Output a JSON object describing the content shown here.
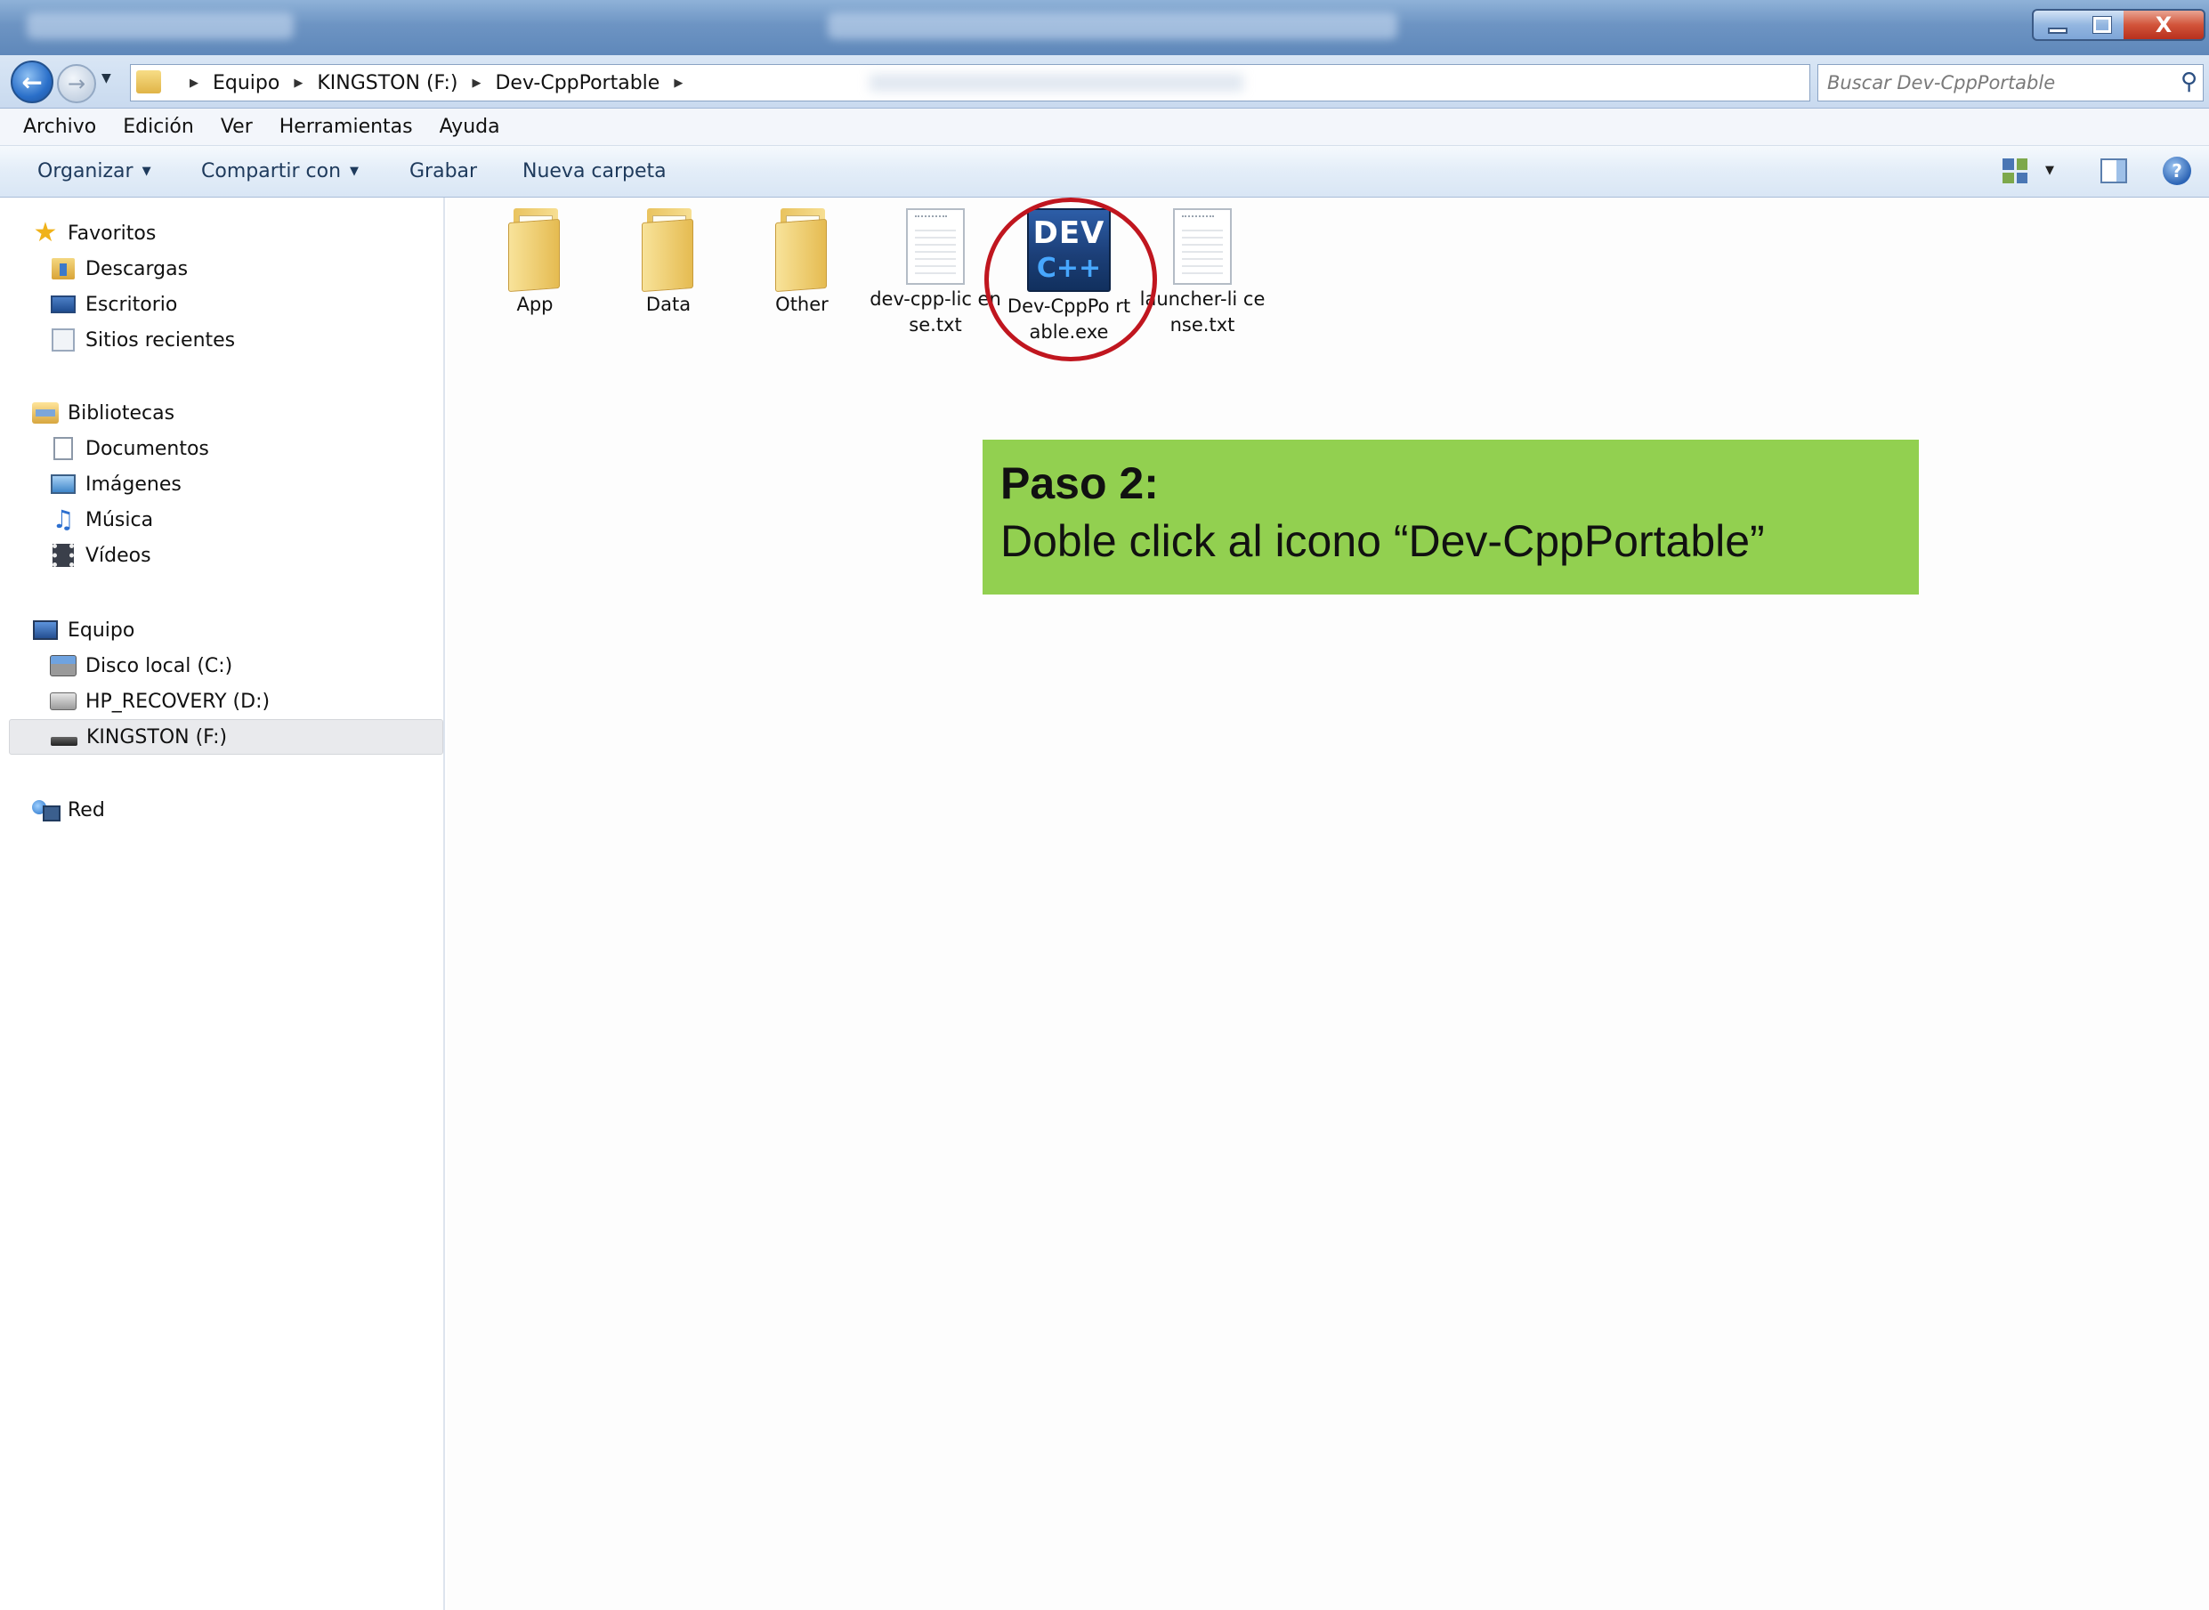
{
  "window": {
    "title": "",
    "controls": {
      "minimize": "–",
      "maximize": "□",
      "close": "X"
    }
  },
  "navigation": {
    "back_icon": "back-arrow-icon",
    "forward_icon": "forward-arrow-icon",
    "breadcrumbs": [
      "Equipo",
      "KINGSTON (F:)",
      "Dev-CppPortable"
    ],
    "search_placeholder": "Buscar Dev-CppPortable"
  },
  "menubar": {
    "items": [
      "Archivo",
      "Edición",
      "Ver",
      "Herramientas",
      "Ayuda"
    ]
  },
  "commandbar": {
    "organize": "Organizar",
    "share": "Compartir con",
    "burn": "Grabar",
    "new_folder": "Nueva carpeta",
    "help": "?"
  },
  "sidebar": {
    "favorites": {
      "label": "Favoritos",
      "items": [
        "Descargas",
        "Escritorio",
        "Sitios recientes"
      ]
    },
    "libraries": {
      "label": "Bibliotecas",
      "items": [
        "Documentos",
        "Imágenes",
        "Música",
        "Vídeos"
      ]
    },
    "computer": {
      "label": "Equipo",
      "items": [
        "Disco local (C:)",
        "HP_RECOVERY (D:)",
        "KINGSTON (F:)"
      ],
      "selected": "KINGSTON (F:)"
    },
    "network": {
      "label": "Red"
    }
  },
  "files": [
    {
      "name": "App",
      "type": "folder"
    },
    {
      "name": "Data",
      "type": "folder"
    },
    {
      "name": "Other",
      "type": "folder"
    },
    {
      "name": "dev-cpp-license.txt",
      "label": "dev-cpp-lic ense.txt",
      "type": "text"
    },
    {
      "name": "Dev-CppPortable.exe",
      "label": "Dev-CppPo rtable.exe",
      "type": "exe",
      "icon_line1": "DEV",
      "icon_line2": "C++"
    },
    {
      "name": "launcher-license.txt",
      "label": "launcher-li cense.txt",
      "type": "text"
    }
  ],
  "annotation": {
    "title": "Paso 2:",
    "text": "Doble click al icono “Dev-CppPortable”",
    "highlight_color": "#c0161f",
    "background": "#92d050"
  }
}
